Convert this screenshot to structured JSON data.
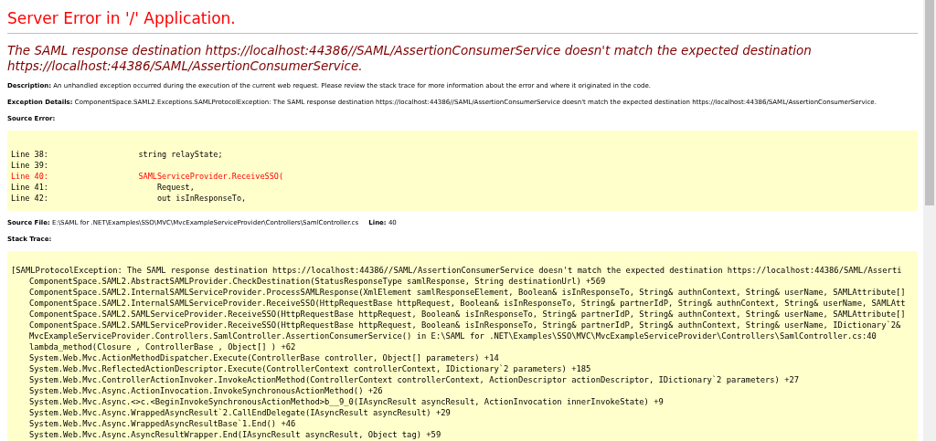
{
  "title": "Server Error in '/' Application.",
  "message": "The SAML response destination https://localhost:44386//SAML/AssertionConsumerService doesn't match the expected destination https://localhost:44386/SAML/AssertionConsumerService.",
  "description": {
    "label": "Description:",
    "text": "An unhandled exception occurred during the execution of the current web request. Please review the stack trace for more information about the error and where it originated in the code."
  },
  "exception_details": {
    "label": "Exception Details:",
    "text": "ComponentSpace.SAML2.Exceptions.SAMLProtocolException: The SAML response destination https://localhost:44386//SAML/AssertionConsumerService doesn't match the expected destination https://localhost:44386/SAML/AssertionConsumerService."
  },
  "source_error": {
    "label": "Source Error:",
    "lines": [
      {
        "number": "Line 38:",
        "code": "            string relayState;",
        "highlighted": false
      },
      {
        "number": "Line 39:",
        "highlighted": false
      },
      {
        "number": "Line 40:",
        "code": "            SAMLServiceProvider.ReceiveSSO(",
        "highlighted": true
      },
      {
        "number": "Line 41:",
        "code": "                Request,",
        "highlighted": false
      },
      {
        "number": "Line 42:",
        "code": "                out isInResponseTo,",
        "highlighted": false
      }
    ]
  },
  "source_file": {
    "label": "Source File:",
    "path": "E:\\SAML for .NET\\Examples\\SSO\\MVC\\MvcExampleServiceProvider\\Controllers\\SamlController.cs",
    "line_label": "Line:",
    "line": "40"
  },
  "stack_trace": {
    "label": "Stack Trace:",
    "lines": [
      {
        "kind": "exception",
        "text": "[SAMLProtocolException: The SAML response destination https://localhost:44386//SAML/AssertionConsumerService doesn't match the expected destination https://localhost:44386/SAML/Asserti"
      },
      {
        "kind": "frame",
        "text": "ComponentSpace.SAML2.AbstractSAMLProvider.CheckDestination(StatusResponseType samlResponse, String destinationUrl) +569"
      },
      {
        "kind": "frame",
        "text": "ComponentSpace.SAML2.InternalSAMLServiceProvider.ProcessSAMLResponse(XmlElement samlResponseElement, Boolean& isInResponseTo, String& authnContext, String& userName, SAMLAttribute[]"
      },
      {
        "kind": "frame",
        "text": "ComponentSpace.SAML2.InternalSAMLServiceProvider.ReceiveSSO(HttpRequestBase httpRequest, Boolean& isInResponseTo, String& partnerIdP, String& authnContext, String& userName, SAMLAtt"
      },
      {
        "kind": "frame",
        "text": "ComponentSpace.SAML2.SAMLServiceProvider.ReceiveSSO(HttpRequestBase httpRequest, Boolean& isInResponseTo, String& partnerIdP, String& authnContext, String& userName, SAMLAttribute[]"
      },
      {
        "kind": "frame",
        "text": "ComponentSpace.SAML2.SAMLServiceProvider.ReceiveSSO(HttpRequestBase httpRequest, Boolean& isInResponseTo, String& partnerIdP, String& authnContext, String& userName, IDictionary`2&"
      },
      {
        "kind": "frame",
        "text": "MvcExampleServiceProvider.Controllers.SamlController.AssertionConsumerService() in E:\\SAML for .NET\\Examples\\SSO\\MVC\\MvcExampleServiceProvider\\Controllers\\SamlController.cs:40"
      },
      {
        "kind": "frame",
        "text": "lambda_method(Closure , ControllerBase , Object[] ) +62"
      },
      {
        "kind": "frame",
        "text": "System.Web.Mvc.ActionMethodDispatcher.Execute(ControllerBase controller, Object[] parameters) +14"
      },
      {
        "kind": "frame",
        "text": "System.Web.Mvc.ReflectedActionDescriptor.Execute(ControllerContext controllerContext, IDictionary`2 parameters) +185"
      },
      {
        "kind": "frame",
        "text": "System.Web.Mvc.ControllerActionInvoker.InvokeActionMethod(ControllerContext controllerContext, ActionDescriptor actionDescriptor, IDictionary`2 parameters) +27"
      },
      {
        "kind": "frame",
        "text": "System.Web.Mvc.Async.ActionInvocation.InvokeSynchronousActionMethod() +26"
      },
      {
        "kind": "frame",
        "text": "System.Web.Mvc.Async.<>c.<BeginInvokeSynchronousActionMethod>b__9_0(IAsyncResult asyncResult, ActionInvocation innerInvokeState) +9"
      },
      {
        "kind": "frame",
        "text": "System.Web.Mvc.Async.WrappedAsyncResult`2.CallEndDelegate(IAsyncResult asyncResult) +29"
      },
      {
        "kind": "frame",
        "text": "System.Web.Mvc.Async.WrappedAsyncResultBase`1.End() +46"
      },
      {
        "kind": "frame",
        "text": "System.Web.Mvc.Async.AsyncResultWrapper.End(IAsyncResult asyncResult, Object tag) +59"
      }
    ]
  }
}
